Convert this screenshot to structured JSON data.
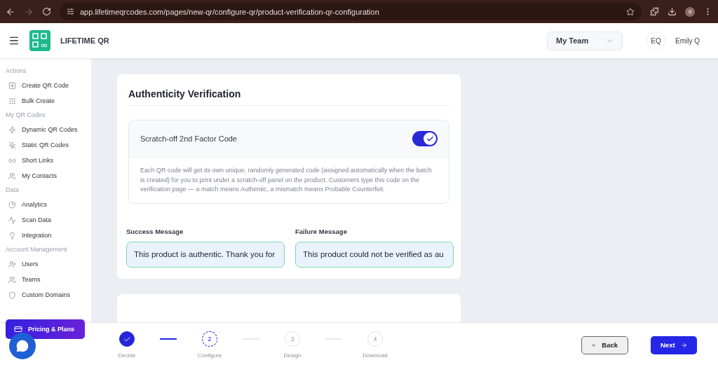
{
  "browser": {
    "url": "app.lifetimeqrcodes.com/pages/new-qr/configure-qr/product-verification-qr-configuration",
    "profile_initial": "d"
  },
  "header": {
    "brand": "LIFETIME QR",
    "team_select": {
      "value": "My Team"
    },
    "user": {
      "initials": "EQ",
      "name": "Emily Q"
    }
  },
  "sidebar": {
    "sections": [
      {
        "title": "Actions",
        "items": [
          {
            "label": "Create QR Code"
          },
          {
            "label": "Bulk Create"
          }
        ]
      },
      {
        "title": "My QR Codes",
        "items": [
          {
            "label": "Dynamic QR Codes"
          },
          {
            "label": "Static QR Codes"
          },
          {
            "label": "Short Links"
          },
          {
            "label": "My Contacts"
          }
        ]
      },
      {
        "title": "Data",
        "items": [
          {
            "label": "Analytics"
          },
          {
            "label": "Scan Data"
          },
          {
            "label": "Integration"
          }
        ]
      },
      {
        "title": "Account Management",
        "items": [
          {
            "label": "Users"
          },
          {
            "label": "Teams"
          },
          {
            "label": "Custom Domains"
          }
        ]
      }
    ],
    "pricing_button": "Pricing & Plans"
  },
  "card": {
    "title": "Authenticity Verification",
    "toggle": {
      "label": "Scratch-off 2nd Factor Code",
      "on": true
    },
    "description": "Each QR code will get its own unique, randomly generated code (assigned automatically when the batch is created) for you to print under a scratch-off panel on the product. Customers type this code on the verification page — a match means Authentic, a mismatch means Probable Counterfeit.",
    "messages": [
      {
        "label": "Success Message",
        "value": "This product is authentic. Thank you for"
      },
      {
        "label": "Failure Message",
        "value": "This product could not be verified as au"
      }
    ]
  },
  "steps": [
    {
      "label": "Decide",
      "done": true,
      "current": false
    },
    {
      "number": "2",
      "label": "Configure",
      "done": false,
      "current": true
    },
    {
      "number": "3",
      "label": "Design",
      "done": false,
      "current": false
    },
    {
      "number": "4",
      "label": "Download",
      "done": false,
      "current": false
    }
  ],
  "buttons": {
    "back": "Back",
    "next": "Next"
  }
}
